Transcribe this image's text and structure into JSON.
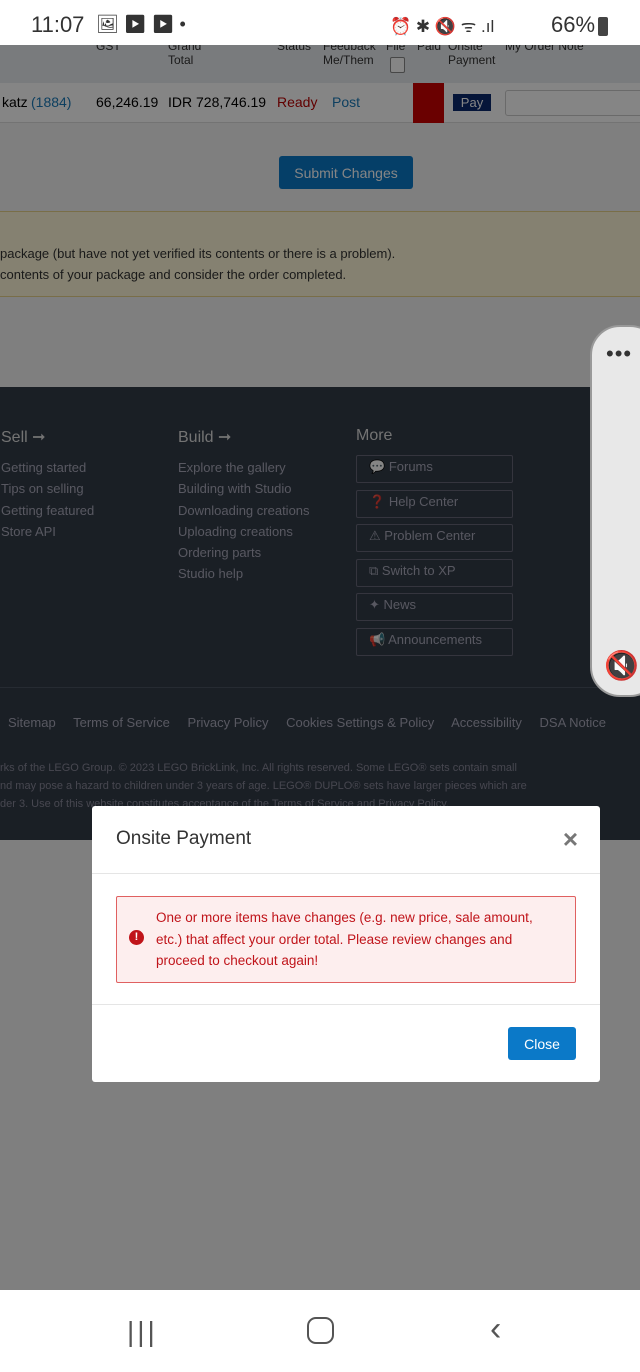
{
  "status_bar": {
    "time": "11:07",
    "battery": "66%"
  },
  "table": {
    "headers": [
      "GST",
      "Grand Total",
      "Status",
      "Feedback Me/Them",
      "File",
      "Paid",
      "Onsite Payment",
      "My Order Note"
    ],
    "row": {
      "seller": "katz",
      "feedback_count": "(1884)",
      "gst": "66,246.19",
      "grand_total": "IDR 728,746.19",
      "status": "Ready",
      "feedback": "Post",
      "pay": "Pay"
    }
  },
  "submit_label": "Submit Changes",
  "notice": [
    "package (but have not yet verified its contents or there is a problem).",
    "contents of your package and consider the order completed."
  ],
  "footer": {
    "sell": {
      "title": "Sell ➞",
      "items": [
        "Getting started",
        "Tips on selling",
        "Getting featured",
        "Store API"
      ]
    },
    "build": {
      "title": "Build ➞",
      "items": [
        "Explore the gallery",
        "Building with Studio",
        "Downloading creations",
        "Uploading creations",
        "Ordering parts",
        "Studio help"
      ]
    },
    "more": {
      "title": "More",
      "items": [
        "Forums",
        "Help Center",
        "Problem Center",
        "Switch to XP",
        "News",
        "Announcements"
      ]
    },
    "links": [
      "Sitemap",
      "Terms of Service",
      "Privacy Policy",
      "Cookies Settings & Policy",
      "Accessibility",
      "DSA Notice"
    ],
    "copyright": [
      "rks of the LEGO Group. © 2023 LEGO BrickLink, Inc. All rights reserved. Some LEGO® sets contain small",
      "nd may pose a hazard to children under 3 years of age. LEGO® DUPLO® sets have larger pieces which are",
      "der 3. Use of this website constitutes acceptance of the Terms of Service and Privacy Policy."
    ]
  },
  "modal": {
    "title": "Onsite Payment",
    "message": "One or more items have changes (e.g. new price, sale amount, etc.) that affect your order total. Please review changes and proceed to checkout again!",
    "close_label": "Close"
  },
  "colors": {
    "accent": "#0b79c8",
    "error": "#c0141a",
    "paid_red": "#cc0000"
  }
}
